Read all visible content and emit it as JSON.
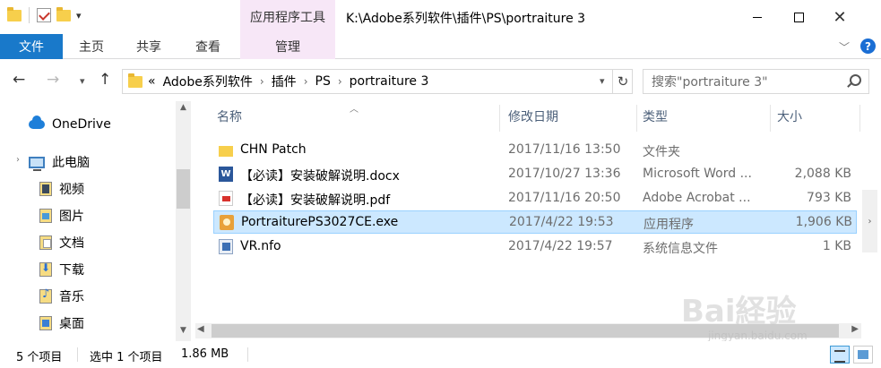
{
  "window": {
    "title": "K:\\Adobe系列软件\\插件\\PS\\portraiture 3",
    "tools_tab": "应用程序工具"
  },
  "ribbon": {
    "file": "文件",
    "home": "主页",
    "share": "共享",
    "view": "查看",
    "manage": "管理"
  },
  "address": {
    "overflow": "«",
    "crumbs": [
      "Adobe系列软件",
      "插件",
      "PS",
      "portraiture 3"
    ],
    "search_placeholder": "搜索\"portraiture 3\""
  },
  "nav": {
    "onedrive": "OneDrive",
    "this_pc": "此电脑",
    "items": [
      "视频",
      "图片",
      "文档",
      "下载",
      "音乐",
      "桌面"
    ]
  },
  "columns": {
    "name": "名称",
    "date": "修改日期",
    "type": "类型",
    "size": "大小"
  },
  "files": [
    {
      "name": "CHN Patch",
      "date": "2017/11/16 13:50",
      "type": "文件夹",
      "size": "",
      "icon": "folder-icon"
    },
    {
      "name": "【必读】安装破解说明.docx",
      "date": "2017/10/27 13:36",
      "type": "Microsoft Word ...",
      "size": "2,088 KB",
      "icon": "word-doc-icon"
    },
    {
      "name": "【必读】安装破解说明.pdf",
      "date": "2017/11/16 20:50",
      "type": "Adobe Acrobat ...",
      "size": "793 KB",
      "icon": "pdf-icon"
    },
    {
      "name": "PortraiturePS3027CE.exe",
      "date": "2017/4/22 19:53",
      "type": "应用程序",
      "size": "1,906 KB",
      "icon": "exe-icon"
    },
    {
      "name": "VR.nfo",
      "date": "2017/4/22 19:57",
      "type": "系统信息文件",
      "size": "1 KB",
      "icon": "nfo-icon"
    }
  ],
  "status": {
    "count": "5 个项目",
    "selected": "选中 1 个项目",
    "size": "1.86 MB"
  },
  "watermark": {
    "brand": "Bai経验",
    "url": "jingyan.baidu.com"
  },
  "colors": {
    "accent": "#1979ca",
    "selection": "#cce8ff",
    "tools_tab": "#f7e7f7"
  }
}
